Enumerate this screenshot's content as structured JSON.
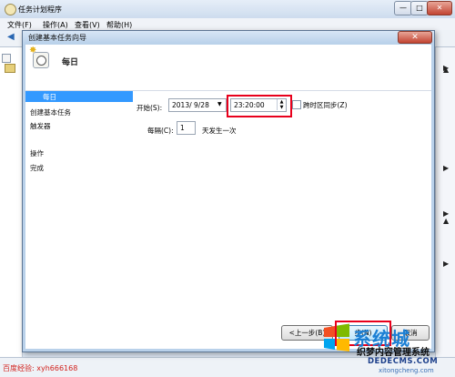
{
  "main_window": {
    "title": "任务计划程序",
    "menu": [
      "文件(F)",
      "操作(A)",
      "查看(V)",
      "帮助(H)"
    ],
    "min_label": "—",
    "max_label": "□",
    "close_label": "✕"
  },
  "wizard": {
    "title": "创建基本任务向导",
    "close_label": "✕",
    "page_title": "每日",
    "nav": {
      "create_basic_task": "创建基本任务",
      "trigger": "触发器",
      "daily": "每日",
      "action": "操作",
      "finish": "完成"
    },
    "start": {
      "label": "开始(S):",
      "date": "2013/ 9/28",
      "time": "23:20:00",
      "sync_label": "跨时区同步(Z)",
      "sync_checked": false
    },
    "recur": {
      "label": "每隔(C):",
      "value": "1",
      "suffix": "天发生一次"
    },
    "buttons": {
      "back": "<上一步(B)",
      "next": "步(N)",
      "cancel": "取消"
    }
  },
  "status_bar": {
    "watermark": "百度经验: xyh666168"
  },
  "site_logo": {
    "brand": "系统城",
    "title": "织梦内容管理系统",
    "url": "DEDECMS.COM",
    "url2": "xitongcheng.com"
  },
  "colors": {
    "selection": "#3399ff",
    "highlight_box": "#e8001c",
    "watermark_text": "#d2231e"
  }
}
